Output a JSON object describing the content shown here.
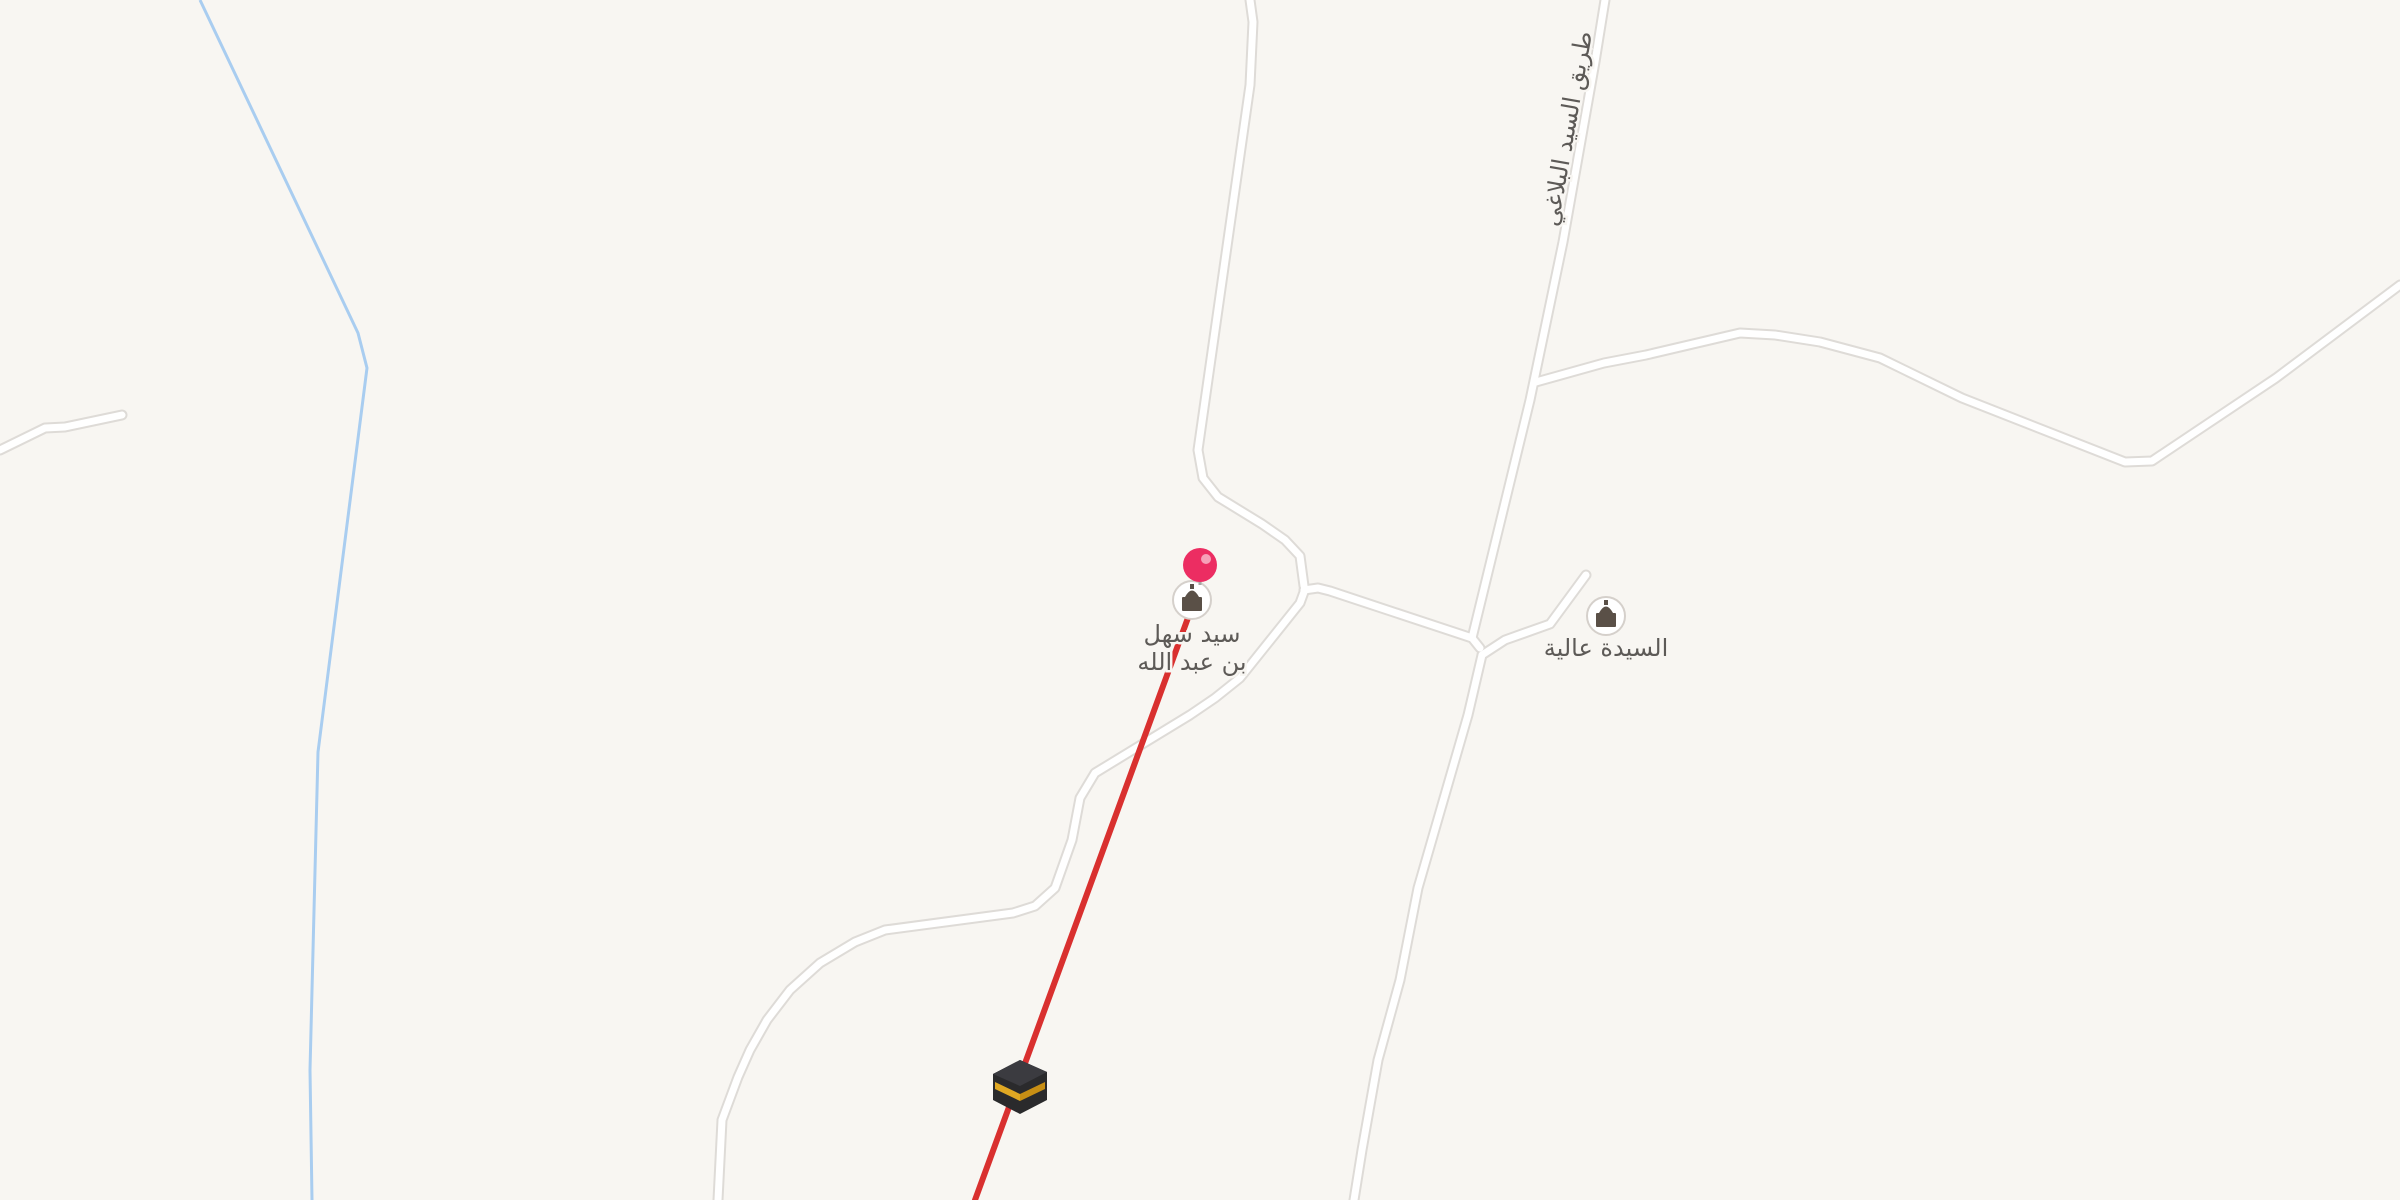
{
  "map": {
    "background_color": "#f8f6f2",
    "road_color": "#ffffff",
    "road_casing_color": "#dedbd7",
    "waterway_color": "#a9cdf0",
    "qibla_line_color": "#d9302f",
    "marker_color": "#ec2d62"
  },
  "roads": {
    "labels": [
      {
        "text": "طريق السيد البلاغي",
        "icon": null
      }
    ]
  },
  "pois": [
    {
      "name_line1": "سيد سهل",
      "name_line2": "بن عبد الله",
      "icon": "mosque-icon",
      "icon_bg": "#ffffff",
      "icon_fg": "#5a5047"
    },
    {
      "name_line1": "السيدة عالية",
      "name_line2": "",
      "icon": "mosque-icon",
      "icon_bg": "#ffffff",
      "icon_fg": "#5a5047"
    }
  ],
  "qibla": {
    "kaaba_icon": "kaaba-icon",
    "location_marker_icon": "location-pin-icon"
  }
}
